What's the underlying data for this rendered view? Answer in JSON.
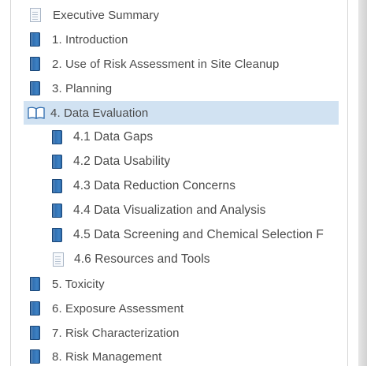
{
  "toc": {
    "items": [
      {
        "label": "Executive Summary",
        "icon": "document-icon",
        "level": 0,
        "selected": false
      },
      {
        "label": "1. Introduction",
        "icon": "book-icon",
        "level": 0,
        "selected": false
      },
      {
        "label": "2. Use of Risk Assessment in Site Cleanup",
        "icon": "book-icon",
        "level": 0,
        "selected": false
      },
      {
        "label": "3. Planning",
        "icon": "book-icon",
        "level": 0,
        "selected": false
      },
      {
        "label": "4. Data Evaluation",
        "icon": "open-book-icon",
        "level": 0,
        "selected": true
      },
      {
        "label": "4.1 Data Gaps",
        "icon": "book-icon",
        "level": 1,
        "selected": false
      },
      {
        "label": "4.2 Data Usability",
        "icon": "book-icon",
        "level": 1,
        "selected": false
      },
      {
        "label": "4.3 Data Reduction Concerns",
        "icon": "book-icon",
        "level": 1,
        "selected": false
      },
      {
        "label": "4.4 Data Visualization and Analysis",
        "icon": "book-icon",
        "level": 1,
        "selected": false
      },
      {
        "label": "4.5 Data Screening and Chemical Selection F",
        "icon": "book-icon",
        "level": 1,
        "selected": false
      },
      {
        "label": "4.6 Resources and Tools",
        "icon": "document-icon",
        "level": 1,
        "selected": false
      },
      {
        "label": "5. Toxicity",
        "icon": "book-icon",
        "level": 0,
        "selected": false
      },
      {
        "label": "6. Exposure Assessment",
        "icon": "book-icon",
        "level": 0,
        "selected": false
      },
      {
        "label": "7. Risk Characterization",
        "icon": "book-icon",
        "level": 0,
        "selected": false
      },
      {
        "label": "8. Risk Management",
        "icon": "book-icon",
        "level": 0,
        "selected": false
      }
    ]
  },
  "colors": {
    "selected_row": "#d1e2f2",
    "text": "#4a4a4a",
    "book_blue": "#2f6cae"
  }
}
